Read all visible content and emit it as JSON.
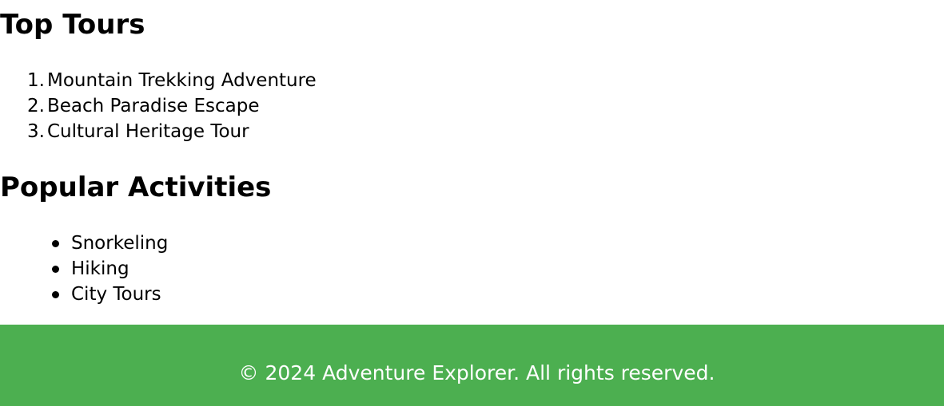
{
  "sections": {
    "top_tours": {
      "title": "Top Tours",
      "items": [
        {
          "number": "1.",
          "label": "Mountain Trekking Adventure"
        },
        {
          "number": "2.",
          "label": "Beach Paradise Escape"
        },
        {
          "number": "3.",
          "label": "Cultural Heritage Tour"
        }
      ]
    },
    "popular_activities": {
      "title": "Popular Activities",
      "items": [
        {
          "label": "Snorkeling"
        },
        {
          "label": "Hiking"
        },
        {
          "label": "City Tours"
        }
      ]
    }
  },
  "footer": {
    "text": "© 2024 Adventure Explorer. All rights reserved.",
    "background_color": "#4caf50",
    "text_color": "#ffffff"
  }
}
